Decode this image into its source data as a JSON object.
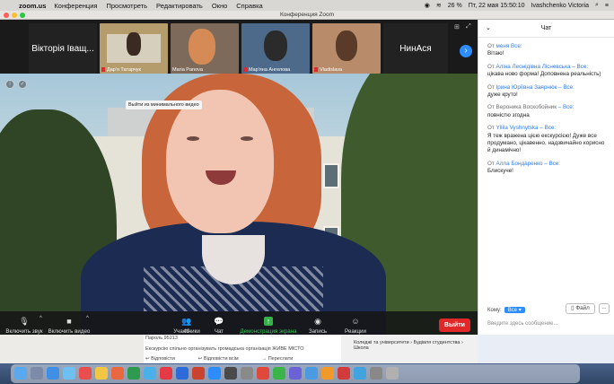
{
  "menubar": {
    "app": "zoom.us",
    "items": [
      "Конференция",
      "Просмотреть",
      "Редактировать",
      "Окно",
      "Справка"
    ],
    "battery": "26 %",
    "clock": "Пт, 22 мая  15:50:10",
    "user": "Ivashchenko Victoria"
  },
  "window": {
    "title": "Конференция Zoom"
  },
  "participants": [
    {
      "name": "Вікторія Іващ...",
      "has_video": false
    },
    {
      "name": "Дар'я Татарчук",
      "has_video": true,
      "color": "#b59c6d"
    },
    {
      "name": "Maria Panova",
      "has_video": true,
      "color": "#7e6a5a"
    },
    {
      "name": "Мар'яна Ангелова",
      "has_video": true,
      "color": "#4d6a8a"
    },
    {
      "name": "Vladislava",
      "has_video": true,
      "color": "#b88c6a"
    },
    {
      "name": "НинАся",
      "has_video": false
    }
  ],
  "video": {
    "tooltip": "Выйти из минимального видео"
  },
  "toolbar": {
    "mute": "Включить звук",
    "video": "Включить видео",
    "participants": "Участники",
    "participants_count": "49",
    "chat": "Чат",
    "share": "Демонстрация экрана",
    "record": "Запись",
    "reactions": "Реакции",
    "leave": "Выйти"
  },
  "chat": {
    "title": "Чат",
    "messages": [
      {
        "prefix": "От",
        "sender": "меня",
        "to": "Все:",
        "text": "Вітаю!"
      },
      {
        "prefix": "От",
        "sender": "Аліна Леонідівна Лісневська",
        "to": "– Все:",
        "text": "цікава ново форма! Доповнена реальність)"
      },
      {
        "prefix": "От",
        "sender": "Ірина Юріївна Заярнюк",
        "to": "– Все:",
        "text": "дуже круто!"
      },
      {
        "prefix": "От",
        "sender": "Вероника Воскобойник",
        "to": "– Все:",
        "text": "повністю згодна"
      },
      {
        "prefix": "От",
        "sender": "Yllila Vyshnytska",
        "to": "– Все:",
        "text": "Я теж вражена цією екскурсією! Дуже все продумано, цікавенно, надзвичайно корисно й динамічно!"
      },
      {
        "prefix": "От",
        "sender": "Алла Бондаренко",
        "to": "– Все:",
        "text": "Блискуче!"
      }
    ],
    "to_label": "Кому:",
    "to_value": "Все",
    "file_button": "Файл",
    "more": "...",
    "placeholder": "Введите здесь сообщение..."
  },
  "background": {
    "password": "Пароль 95213",
    "excursion": "Екскурсію спільно організувать громадська організація ЖИВЕ МІСТО",
    "reply": "Відповісти",
    "reply_all": "Відповісти всім",
    "forward": "Переслати",
    "colleges": "Коледжі та університети › Будівля студентства › Школа"
  }
}
